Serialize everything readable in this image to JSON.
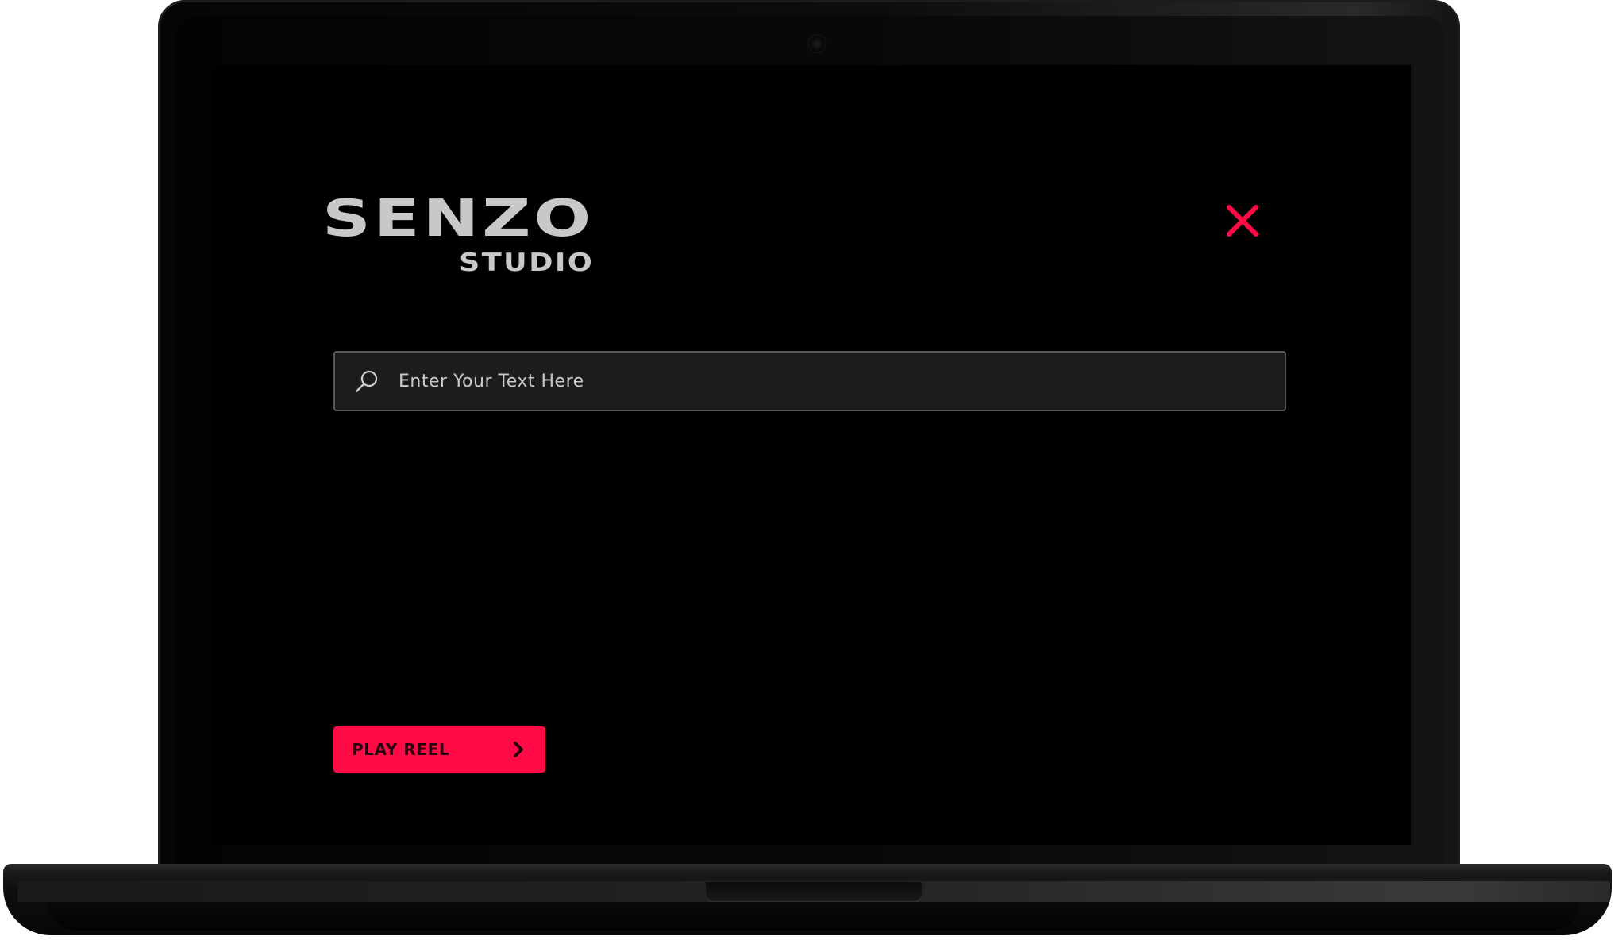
{
  "brand": {
    "wordmark": "SENZO",
    "subword": "STUDIO",
    "text_color": "#c8c8c8"
  },
  "search": {
    "placeholder": "Enter Your Text Here",
    "value": "",
    "icon": "search-icon"
  },
  "close": {
    "icon": "close-icon",
    "color": "#ff0a45"
  },
  "cta": {
    "label": "PLAY REEL",
    "icon": "chevron-right-icon",
    "color": "#ff0a45"
  },
  "theme": {
    "screen_background": "#000000",
    "input_background": "#1c1c1c",
    "accent": "#ff0a45"
  }
}
